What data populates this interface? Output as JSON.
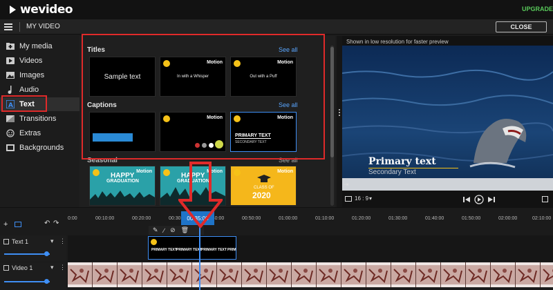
{
  "app": {
    "logo": "wevideo",
    "upgrade_label": "UPGRADE"
  },
  "menubar": {
    "project_title": "MY VIDEO",
    "close_label": "CLOSE"
  },
  "sidebar": {
    "items": [
      {
        "label": "My media",
        "icon": "plus-folder-icon"
      },
      {
        "label": "Videos",
        "icon": "video-icon"
      },
      {
        "label": "Images",
        "icon": "image-icon"
      },
      {
        "label": "Audio",
        "icon": "music-note-icon"
      },
      {
        "label": "Text",
        "icon": "text-icon",
        "active": true
      },
      {
        "label": "Transitions",
        "icon": "transitions-icon"
      },
      {
        "label": "Extras",
        "icon": "extras-icon"
      },
      {
        "label": "Backgrounds",
        "icon": "backgrounds-icon"
      }
    ]
  },
  "panel": {
    "titles": {
      "label": "Titles",
      "see_all": "See all",
      "thumbs": [
        {
          "text": "Sample text",
          "motion": ""
        },
        {
          "text": "In with a Whisper",
          "motion": "Motion"
        },
        {
          "text": "Out with a Puff",
          "motion": "Motion"
        }
      ]
    },
    "captions": {
      "label": "Captions",
      "see_all": "See all",
      "thumbs": [
        {
          "text": "",
          "motion": ""
        },
        {
          "text": "",
          "motion": "Motion"
        },
        {
          "text": "PRIMARY TEXT",
          "subtext": "SECONDARY TEXT",
          "motion": "Motion"
        }
      ]
    },
    "seasonal": {
      "label": "Seasonal",
      "see_all": "See all",
      "thumbs": [
        {
          "line1": "HAPPY",
          "line2": "GRADUATION",
          "motion": "Motion"
        },
        {
          "line1": "HAPPY",
          "line2": "GRADUATION",
          "motion": "Motion"
        },
        {
          "line1": "CLASS OF",
          "line2": "2020",
          "motion": "Motion"
        }
      ]
    }
  },
  "preview": {
    "note": "Shown in low resolution for faster preview",
    "primary_text": "Primary text",
    "secondary_text": "Secondary Text",
    "aspect_ratio": "16 : 9"
  },
  "timeline": {
    "current_time": "00:35:08",
    "ticks": [
      "0:00",
      "00:10:00",
      "00:20:00",
      "00:30:00",
      "00:40:00",
      "00:50:00",
      "01:00:00",
      "01:10:00",
      "01:20:00",
      "01:30:00",
      "01:40:00",
      "01:50:00",
      "02:00:00",
      "02:10:00"
    ],
    "tracks": [
      {
        "name": "Text 1"
      },
      {
        "name": "Video 1"
      }
    ],
    "text_clip": {
      "primary": "PRIMARY TEXT",
      "secondary": "PRIM"
    }
  },
  "colors": {
    "accent": "#3f8ff5",
    "highlight": "#e02a2a",
    "upgrade": "#58c85a",
    "lock": "#f6c218"
  }
}
